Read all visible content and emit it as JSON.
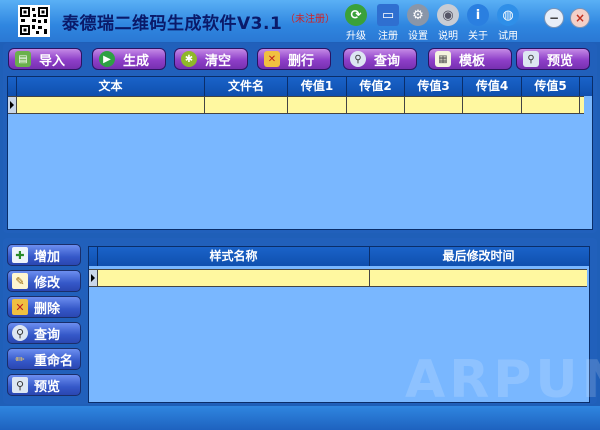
{
  "app": {
    "title": "泰德瑞二维码生成软件V3.1",
    "unregistered": "（未注册）"
  },
  "toolbar": [
    {
      "label": "升级",
      "icon": "upgrade-icon",
      "color": "#3aa13a"
    },
    {
      "label": "注册",
      "icon": "register-icon",
      "color": "#2f6fd0"
    },
    {
      "label": "设置",
      "icon": "settings-icon",
      "color": "#8a96a8"
    },
    {
      "label": "说明",
      "icon": "help-disc-icon",
      "color": "#c8ccd4"
    },
    {
      "label": "关于",
      "icon": "info-icon",
      "color": "#2a7fe0"
    },
    {
      "label": "试用",
      "icon": "trial-globe-icon",
      "color": "#2f8fe8"
    }
  ],
  "window": {
    "minimize": "−",
    "close": "×"
  },
  "actions": [
    {
      "label": "导入",
      "icon": "import-folder-icon"
    },
    {
      "label": "生成",
      "icon": "generate-play-icon"
    },
    {
      "label": "清空",
      "icon": "clear-icon"
    },
    {
      "label": "删行",
      "icon": "delete-row-icon"
    },
    {
      "label": "查询",
      "icon": "search-icon"
    },
    {
      "label": "模板",
      "icon": "template-icon"
    },
    {
      "label": "预览",
      "icon": "preview-icon"
    }
  ],
  "data_table": {
    "columns": [
      "文本",
      "文件名",
      "传值1",
      "传值2",
      "传值3",
      "传值4",
      "传值5"
    ]
  },
  "side_actions": [
    {
      "label": "增加",
      "icon": "add-icon"
    },
    {
      "label": "修改",
      "icon": "edit-icon"
    },
    {
      "label": "删除",
      "icon": "delete-icon"
    },
    {
      "label": "查询",
      "icon": "search-icon"
    },
    {
      "label": "重命名",
      "icon": "rename-pencil-icon"
    },
    {
      "label": "预览",
      "icon": "preview-icon"
    }
  ],
  "style_table": {
    "columns": [
      "样式名称",
      "最后修改时间"
    ]
  },
  "watermark": "ARPUN",
  "colors": {
    "titlebar": "#2f86e0",
    "action_button": "#8e3fc8",
    "grid_background": "#79b7ff",
    "selected_row": "#fff8a0",
    "header": "#1a63c9"
  }
}
